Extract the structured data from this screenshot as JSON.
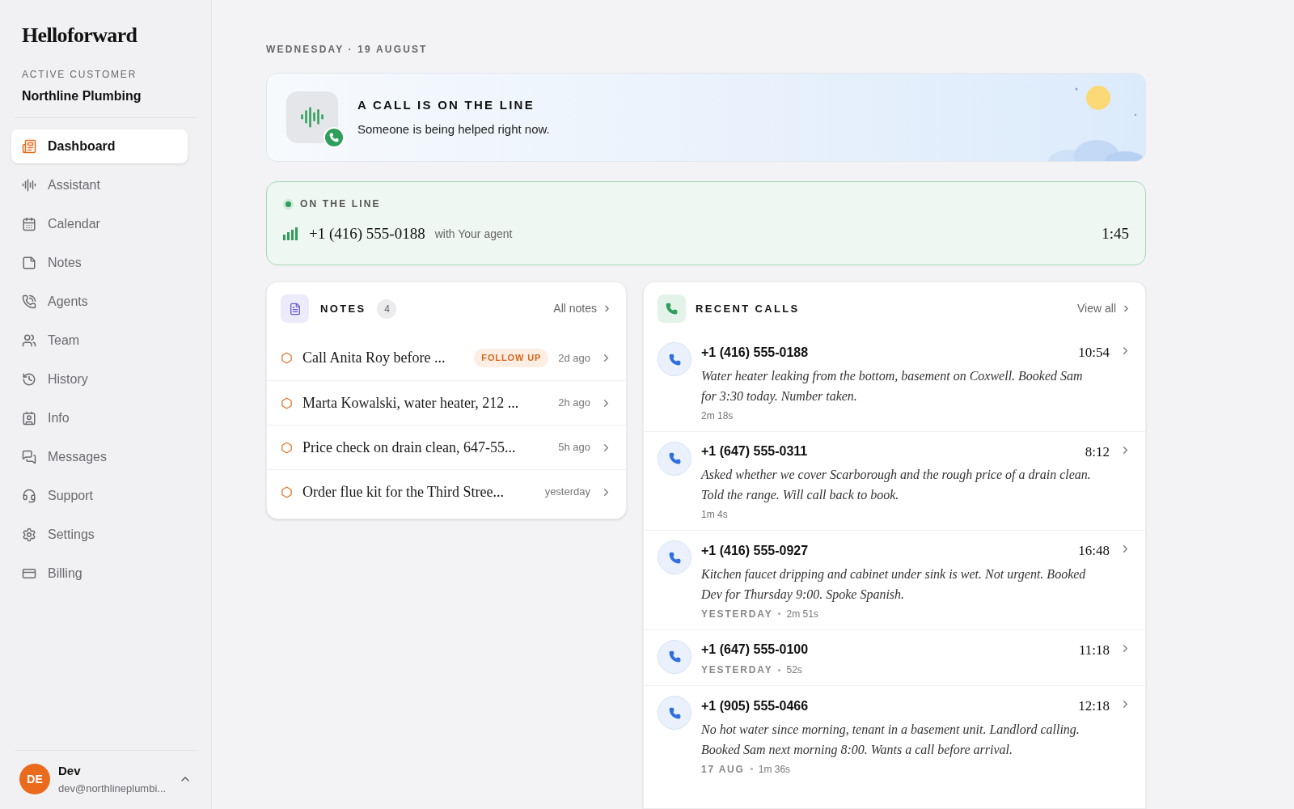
{
  "sidebar": {
    "logo": "Helloforward",
    "customer_label": "ACTIVE CUSTOMER",
    "customer_name": "Northline Plumbing",
    "items": [
      {
        "label": "Dashboard",
        "selected": true
      },
      {
        "label": "Assistant",
        "selected": false
      },
      {
        "label": "Calendar",
        "selected": false
      },
      {
        "label": "Notes",
        "selected": false
      },
      {
        "label": "Agents",
        "selected": false
      },
      {
        "label": "Team",
        "selected": false
      },
      {
        "label": "History",
        "selected": false
      },
      {
        "label": "Info",
        "selected": false
      },
      {
        "label": "Messages",
        "selected": false
      },
      {
        "label": "Support",
        "selected": false
      },
      {
        "label": "Settings",
        "selected": false
      },
      {
        "label": "Billing",
        "selected": false
      }
    ],
    "user": {
      "initials": "DE",
      "name": "Dev",
      "email": "dev@northlineplumbi..."
    }
  },
  "date": "WEDNESDAY · 19 AUGUST",
  "banner": {
    "title": "A CALL IS ON THE LINE",
    "subtitle": "Someone is being helped right now."
  },
  "live": {
    "label": "ON THE LINE",
    "number": "+1 (416) 555-0188",
    "agent": "with Your agent",
    "duration": "1:45"
  },
  "notes": {
    "title": "NOTES",
    "count": "4",
    "link": "All notes",
    "items": [
      {
        "text": "Call Anita Roy before ...",
        "tag": "FOLLOW UP",
        "time": "2d ago"
      },
      {
        "text": "Marta Kowalski, water heater, 212 ...",
        "time": "2h ago"
      },
      {
        "text": "Price check on drain clean, 647-55...",
        "time": "5h ago"
      },
      {
        "text": "Order flue kit for the Third Stree...",
        "time": "yesterday"
      }
    ]
  },
  "recent_calls": {
    "title": "RECENT CALLS",
    "link": "View all",
    "calls": [
      {
        "number": "+1 (416) 555-0188",
        "time": "10:54",
        "summary": "Water heater leaking from the bottom, basement on Coxwell. Booked Sam for 3:30 today. Number taken.",
        "duration": "2m 18s"
      },
      {
        "number": "+1 (647) 555-0311",
        "time": "8:12",
        "summary": "Asked whether we cover Scarborough and the rough price of a drain clean. Told the range. Will call back to book.",
        "duration": "1m 4s"
      },
      {
        "number": "+1 (416) 555-0927",
        "time": "16:48",
        "summary": "Kitchen faucet dripping and cabinet under sink is wet. Not urgent. Booked Dev for Thursday 9:00. Spoke Spanish.",
        "day": "YESTERDAY",
        "duration": "2m 51s"
      },
      {
        "number": "+1 (647) 555-0100",
        "time": "11:18",
        "day": "YESTERDAY",
        "duration": "52s"
      },
      {
        "number": "+1 (905) 555-0466",
        "time": "12:18",
        "summary": "No hot water since morning, tenant in a basement unit. Landlord calling. Booked Sam next morning 8:00. Wants a call before arrival.",
        "day": "17 AUG",
        "duration": "1m 36s"
      }
    ]
  }
}
